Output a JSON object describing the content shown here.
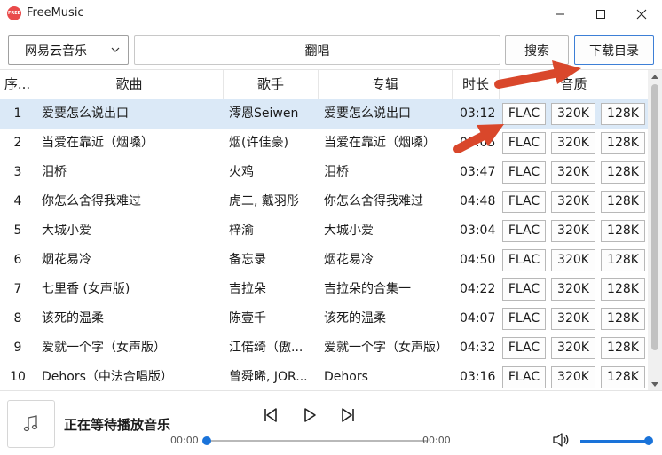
{
  "app": {
    "title": "FreeMusic",
    "logo_text": "FREE"
  },
  "toolbar": {
    "source": "网易云音乐",
    "query": "翻唱",
    "search_label": "搜索",
    "download_dir_label": "下载目录"
  },
  "table": {
    "headers": {
      "index": "序...",
      "song": "歌曲",
      "artist": "歌手",
      "album": "专辑",
      "duration": "时长",
      "quality": "音质"
    },
    "rows": [
      {
        "index": "1",
        "song": "爱要怎么说出口",
        "artist": "澪恩Seiwen",
        "album": "爱要怎么说出口",
        "duration": "03:12",
        "q1": "FLAC",
        "q2": "320K",
        "q3": "128K"
      },
      {
        "index": "2",
        "song": "当爱在靠近（烟嗓）",
        "artist": "烟(许佳豪)",
        "album": "当爱在靠近（烟嗓）",
        "duration": "03:05",
        "q1": "FLAC",
        "q2": "320K",
        "q3": "128K"
      },
      {
        "index": "3",
        "song": "泪桥",
        "artist": "火鸡",
        "album": "泪桥",
        "duration": "03:47",
        "q1": "FLAC",
        "q2": "320K",
        "q3": "128K"
      },
      {
        "index": "4",
        "song": "你怎么舍得我难过",
        "artist": "虎二, 戴羽彤",
        "album": "你怎么舍得我难过",
        "duration": "04:48",
        "q1": "FLAC",
        "q2": "320K",
        "q3": "128K"
      },
      {
        "index": "5",
        "song": "大城小爱",
        "artist": "梓渝",
        "album": "大城小爱",
        "duration": "03:04",
        "q1": "FLAC",
        "q2": "320K",
        "q3": "128K"
      },
      {
        "index": "6",
        "song": "烟花易冷",
        "artist": "备忘录",
        "album": "烟花易冷",
        "duration": "04:50",
        "q1": "FLAC",
        "q2": "320K",
        "q3": "128K"
      },
      {
        "index": "7",
        "song": "七里香 (女声版)",
        "artist": "吉拉朵",
        "album": "吉拉朵的合集一",
        "duration": "04:22",
        "q1": "FLAC",
        "q2": "320K",
        "q3": "128K"
      },
      {
        "index": "8",
        "song": "该死的温柔",
        "artist": "陈壹千",
        "album": "该死的温柔",
        "duration": "04:07",
        "q1": "FLAC",
        "q2": "320K",
        "q3": "128K"
      },
      {
        "index": "9",
        "song": "爱就一个字（女声版）",
        "artist": "江偌绮（傲...",
        "album": "爱就一个字（女声版）",
        "duration": "04:32",
        "q1": "FLAC",
        "q2": "320K",
        "q3": "128K"
      },
      {
        "index": "10",
        "song": "Dehors（中法合唱版）",
        "artist": "曾舜晞, JOR...",
        "album": "Dehors",
        "duration": "03:16",
        "q1": "FLAC",
        "q2": "320K",
        "q3": "128K"
      }
    ]
  },
  "player": {
    "status": "正在等待播放音乐",
    "current_time": "00:00",
    "total_time": "00:00",
    "progress": 0,
    "volume": 1.0
  },
  "colors": {
    "accent": "#1a73d9",
    "selected_row": "#dbe9f7",
    "annotation_arrow": "#d9472b"
  }
}
